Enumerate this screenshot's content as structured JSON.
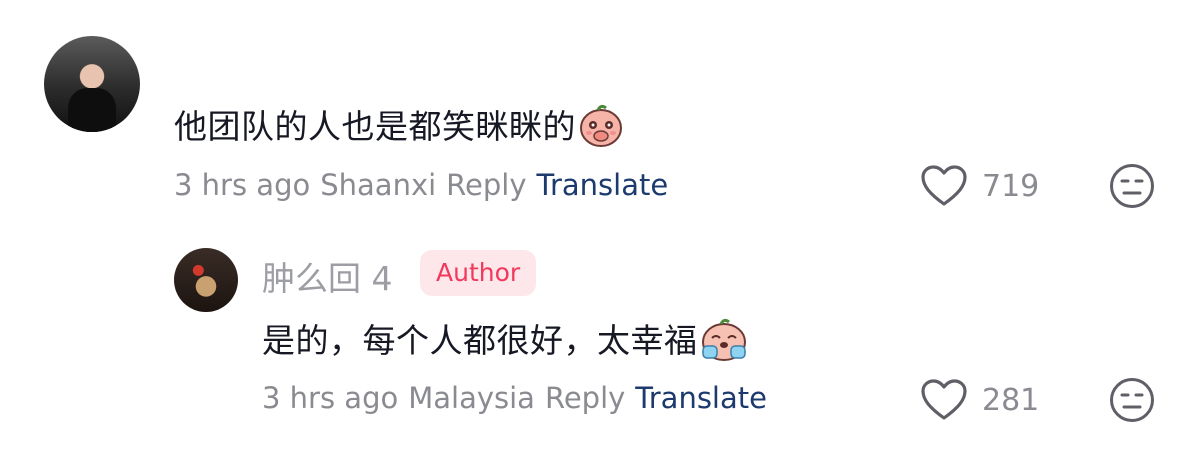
{
  "comment": {
    "text": "他团队的人也是都笑眯眯的",
    "sticker_icon": "shy-peach-sticker-icon",
    "time": "3 hrs ago",
    "location": "Shaanxi",
    "reply_label": "Reply",
    "translate_label": "Translate",
    "likes": "719"
  },
  "reply": {
    "username": "肿么回 4",
    "badge": "Author",
    "text": "是的，每个人都很好，太幸福",
    "sticker_icon": "crying-happy-peach-sticker-icon",
    "time": "3 hrs ago",
    "location": "Malaysia",
    "reply_label": "Reply",
    "translate_label": "Translate",
    "likes": "281"
  },
  "colors": {
    "primary_text": "#161823",
    "secondary_text": "#8a8b91",
    "translate_link": "#1d3a6e",
    "author_badge_bg": "#fde7ea",
    "author_badge_text": "#f2385b"
  }
}
